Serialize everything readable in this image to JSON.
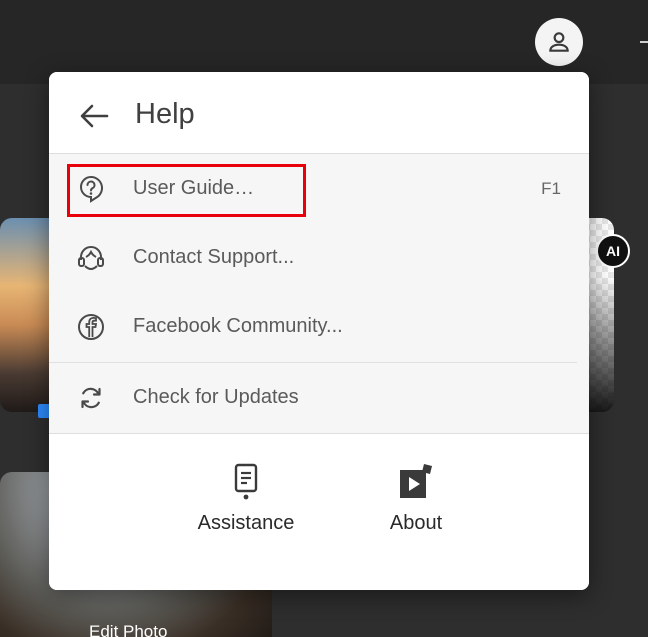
{
  "topbar": {
    "account_icon": "user-avatar-icon"
  },
  "background": {
    "ai_badge": "AI",
    "edit_photo_label": "Edit Photo"
  },
  "help_menu": {
    "title": "Help",
    "back_icon": "arrow-left-icon",
    "items": [
      {
        "label": "User Guide…",
        "shortcut": "F1",
        "icon": "question-bubble-icon"
      },
      {
        "label": "Contact Support...",
        "shortcut": "",
        "icon": "headset-icon"
      },
      {
        "label": "Facebook Community...",
        "shortcut": "",
        "icon": "facebook-icon"
      },
      {
        "label": "Check for Updates",
        "shortcut": "",
        "icon": "refresh-icon"
      }
    ],
    "footer": [
      {
        "label": "Assistance",
        "icon": "assistance-icon"
      },
      {
        "label": "About",
        "icon": "about-icon"
      }
    ]
  },
  "colors": {
    "highlight": "#e8000b",
    "menu_bg": "#f6f6f6",
    "header_bg": "#ffffff",
    "topbar_bg": "#262626"
  }
}
